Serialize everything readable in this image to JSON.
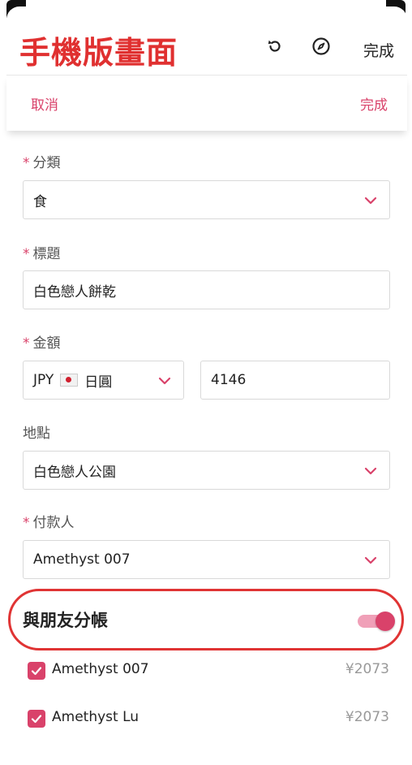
{
  "screen_title": "手機版畫面",
  "topbar": {
    "done_label": "完成",
    "icons": [
      "refresh-icon",
      "compass-icon"
    ]
  },
  "actionbar": {
    "cancel_label": "取消",
    "done_label": "完成"
  },
  "form": {
    "required_mark": "*",
    "category": {
      "label": "分類",
      "value": "食"
    },
    "title": {
      "label": "標題",
      "value": "白色戀人餅乾"
    },
    "amount": {
      "label": "金額",
      "currency_code": "JPY",
      "currency_name": "日圓",
      "value": "4146"
    },
    "location": {
      "label": "地點",
      "value": "白色戀人公園"
    },
    "payer": {
      "label": "付款人",
      "value": "Amethyst 007"
    }
  },
  "split": {
    "label": "與朋友分帳",
    "enabled": true,
    "members": [
      {
        "name": "Amethyst 007",
        "amount": "¥2073",
        "checked": true
      },
      {
        "name": "Amethyst Lu",
        "amount": "¥2073",
        "checked": true
      }
    ]
  },
  "colors": {
    "accent": "#d9426a",
    "annotation": "#e03030"
  }
}
